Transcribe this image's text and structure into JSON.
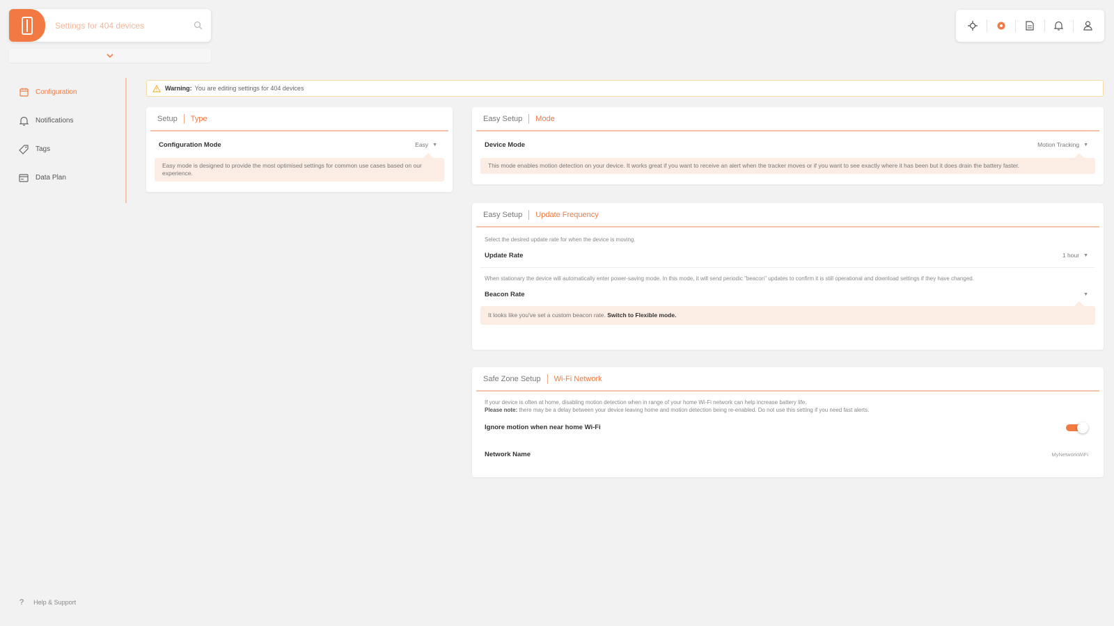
{
  "search": {
    "placeholder": "Settings for 404 devices"
  },
  "colors": {
    "accent": "#f27a42",
    "accent_light": "#fbece4",
    "warning_border": "#f7dca3"
  },
  "toolbar": {
    "icons": [
      "location-icon",
      "settings-icon",
      "document-icon",
      "bell-icon",
      "user-icon"
    ]
  },
  "sidebar": {
    "items": [
      {
        "label": "Configuration",
        "icon": "calendar-icon",
        "active": true
      },
      {
        "label": "Notifications",
        "icon": "bell-icon",
        "active": false
      },
      {
        "label": "Tags",
        "icon": "tag-icon",
        "active": false
      },
      {
        "label": "Data Plan",
        "icon": "data-plan-icon",
        "active": false
      }
    ],
    "help_label": "Help & Support",
    "help_icon": "question-icon"
  },
  "warning": {
    "bold": "Warning:",
    "text": "You are editing settings for 404 devices"
  },
  "setup_card": {
    "crumb": "Setup",
    "accent": "Type",
    "row_label": "Configuration Mode",
    "row_value": "Easy",
    "info": "Easy mode is designed to provide the most optimised settings for common use cases based on our experience."
  },
  "mode_card": {
    "crumb": "Easy Setup",
    "accent": "Mode",
    "row_label": "Device Mode",
    "row_value": "Motion Tracking",
    "info": "This mode enables motion detection on your device. It works great if you want to receive an alert when the tracker moves or if you want to see exactly where it has been but it does drain the battery faster."
  },
  "frequency_card": {
    "crumb": "Easy Setup",
    "accent": "Update Frequency",
    "desc1": "Select the desired update rate for when the device is moving.",
    "row1_label": "Update Rate",
    "row1_value": "1 hour",
    "desc2": "When stationary the device will automatically enter power-saving mode. In this mode, it will send periodic \"beacon\" updates to confirm it is still operational and download settings if they have changed.",
    "row2_label": "Beacon Rate",
    "row2_value": "",
    "info_text": "It looks like you've set a custom beacon rate.",
    "info_link": "Switch to Flexible mode."
  },
  "wifi_card": {
    "crumb": "Safe Zone Setup",
    "accent": "Wi-Fi Network",
    "desc1": "If your device is often at home, disabling motion detection when in range of your home Wi-Fi network can help increase battery life.",
    "note_bold": "Please note:",
    "desc2": "there may be a delay between your device leaving home and motion detection being re-enabled. Do not use this setting if you need fast alerts.",
    "toggle_label": "Ignore motion when near home Wi-Fi",
    "toggle_on": true,
    "network_label": "Network Name",
    "network_value": "MyNetworkWiFi"
  }
}
